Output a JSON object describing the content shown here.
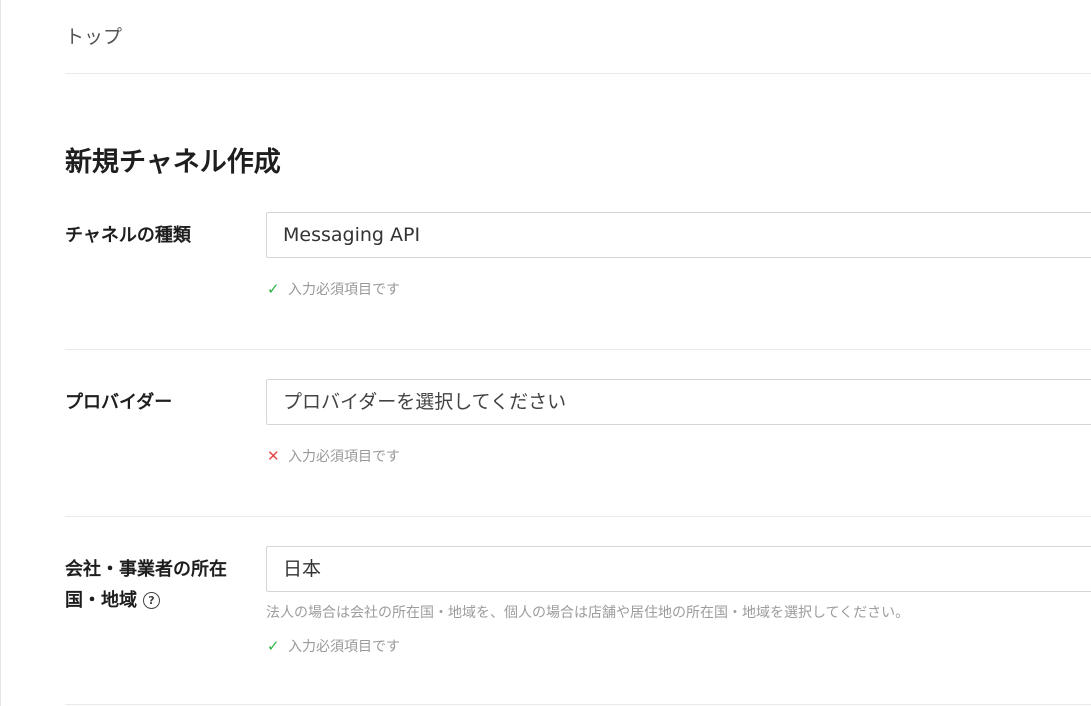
{
  "breadcrumb": {
    "top": "トップ"
  },
  "page": {
    "title": "新規チャネル作成"
  },
  "form": {
    "channel_type": {
      "label": "チャネルの種類",
      "value": "Messaging API",
      "validation": "入力必須項目です",
      "status": "valid"
    },
    "provider": {
      "label": "プロバイダー",
      "placeholder": "プロバイダーを選択してください",
      "validation": "入力必須項目です",
      "status": "invalid"
    },
    "country": {
      "label": "会社・事業者の所在国・地域",
      "value": "日本",
      "hint": "法人の場合は会社の所在国・地域を、個人の場合は店舗や居住地の所在国・地域を選択してください。",
      "validation": "入力必須項目です",
      "status": "valid"
    }
  },
  "icons": {
    "check": "check-icon",
    "cross": "cross-icon",
    "help": "help-icon"
  },
  "colors": {
    "valid": "#2db447",
    "invalid": "#e34848",
    "muted_text": "#999999",
    "border": "#d6d6d6"
  }
}
